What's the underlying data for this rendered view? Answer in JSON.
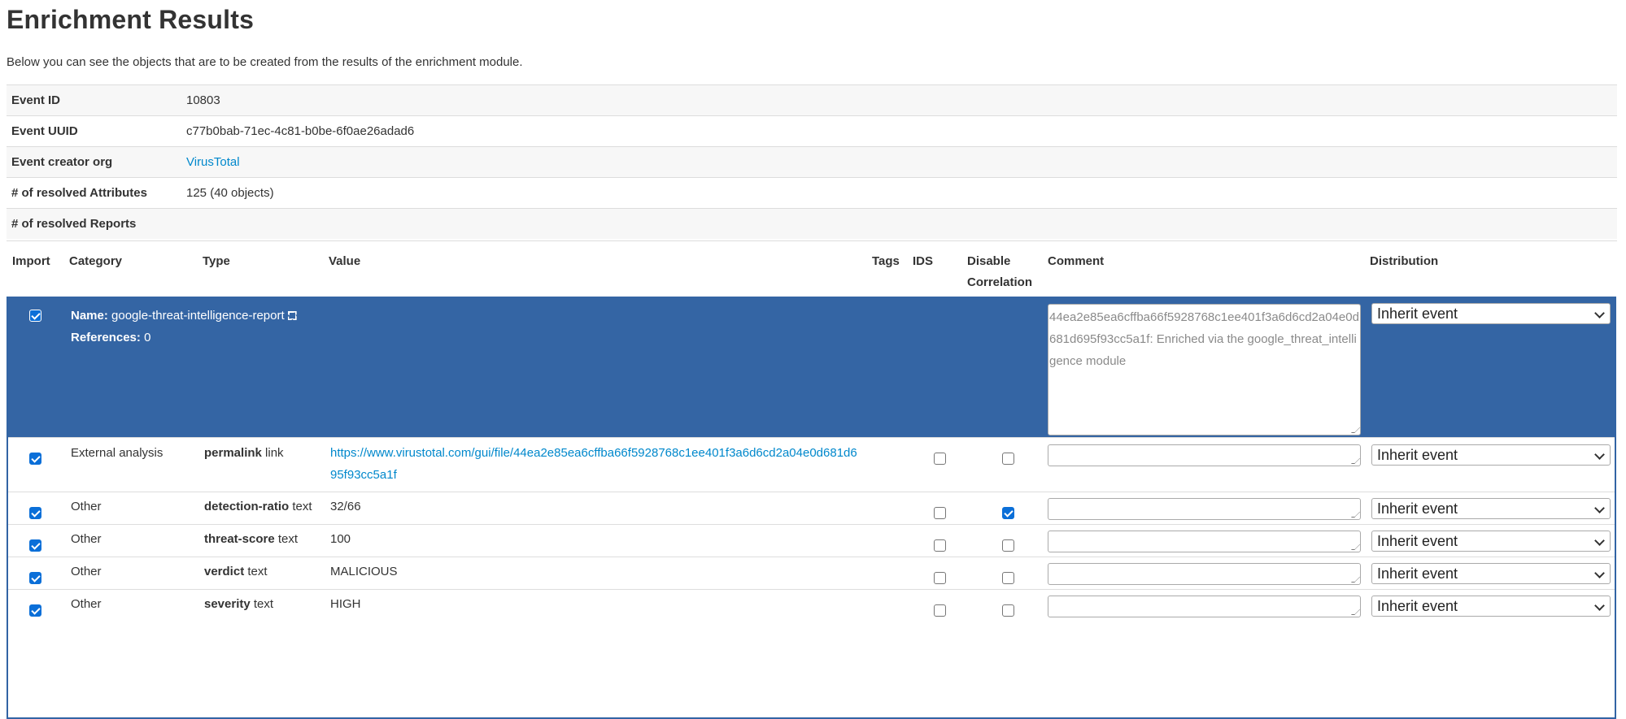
{
  "page": {
    "title": "Enrichment Results",
    "subtitle": "Below you can see the objects that are to be created from the results of the enrichment module."
  },
  "event_info": [
    {
      "key": "Event ID",
      "value": "10803",
      "is_link": false
    },
    {
      "key": "Event UUID",
      "value": "c77b0bab-71ec-4c81-b0be-6f0ae26adad6",
      "is_link": false
    },
    {
      "key": "Event creator org",
      "value": "VirusTotal",
      "is_link": true
    },
    {
      "key": "# of resolved Attributes",
      "value": "125 (40 objects)",
      "is_link": false
    },
    {
      "key": "# of resolved Reports",
      "value": "",
      "is_link": false
    }
  ],
  "columns": {
    "import": "Import",
    "category": "Category",
    "type": "Type",
    "value": "Value",
    "tags": "Tags",
    "ids": "IDS",
    "disable_correlation_1": "Disable",
    "disable_correlation_2": "Correlation",
    "comment": "Comment",
    "distribution": "Distribution"
  },
  "object": {
    "name_label": "Name:",
    "name": "google-threat-intelligence-report",
    "references_label": "References:",
    "references": "0",
    "imported": true,
    "comment": "44ea2e85ea6cffba66f5928768c1ee401f3a6d6cd2a04e0d681d695f93cc5a1f: Enriched via the google_threat_intelligence module",
    "distribution": "Inherit event",
    "attributes": [
      {
        "category": "External analysis",
        "relation": "permalink",
        "type": "link",
        "value": "https://www.virustotal.com/gui/file/44ea2e85ea6cffba66f5928768c1ee401f3a6d6cd2a04e0d681d695f93cc5a1f",
        "is_link": true,
        "import": true,
        "ids": false,
        "disable_correlation": false,
        "distribution": "Inherit event"
      },
      {
        "category": "Other",
        "relation": "detection-ratio",
        "type": "text",
        "value": "32/66",
        "is_link": false,
        "import": true,
        "ids": false,
        "disable_correlation": true,
        "distribution": "Inherit event"
      },
      {
        "category": "Other",
        "relation": "threat-score",
        "type": "text",
        "value": "100",
        "is_link": false,
        "import": true,
        "ids": false,
        "disable_correlation": false,
        "distribution": "Inherit event"
      },
      {
        "category": "Other",
        "relation": "verdict",
        "type": "text",
        "value": "MALICIOUS",
        "is_link": false,
        "import": true,
        "ids": false,
        "disable_correlation": false,
        "distribution": "Inherit event"
      },
      {
        "category": "Other",
        "relation": "severity",
        "type": "text",
        "value": "HIGH",
        "is_link": false,
        "import": true,
        "ids": false,
        "disable_correlation": false,
        "distribution": "Inherit event"
      }
    ]
  },
  "colors": {
    "object_header_bg": "#3465a4",
    "link": "#0088cc",
    "checkbox_checked": "#0b6fd8"
  }
}
